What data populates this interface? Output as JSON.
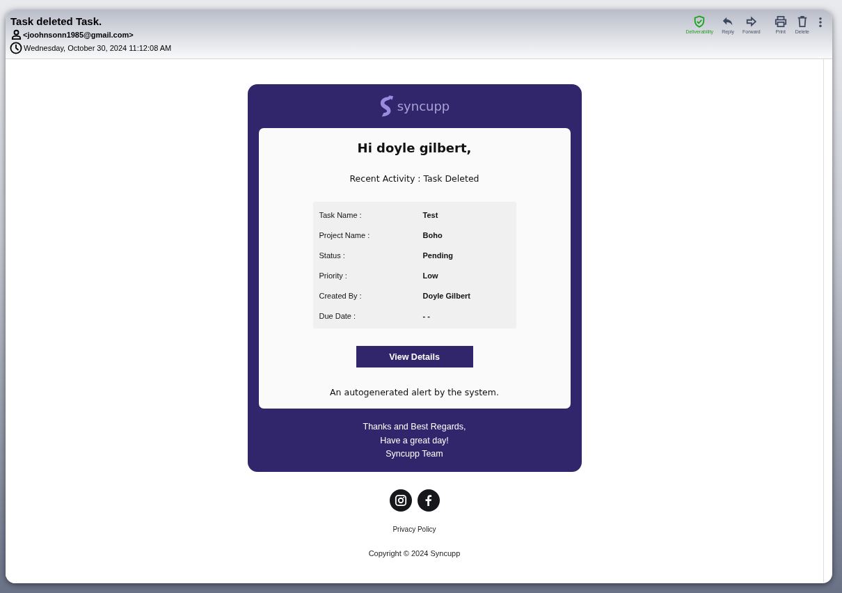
{
  "message": {
    "subject": "Task deleted Task.",
    "sender": "<joohnsonn1985@gmail.com>",
    "date": "Wednesday, October 30, 2024 11:12:08 AM"
  },
  "toolbar": [
    {
      "kind": "deliverability",
      "label": "Deliverability"
    },
    {
      "kind": "reply",
      "label": "Reply"
    },
    {
      "kind": "forward",
      "label": "Forward"
    },
    {
      "kind": "print",
      "label": "Print"
    },
    {
      "kind": "delete",
      "label": "Delete"
    },
    {
      "kind": "more"
    }
  ],
  "email": {
    "logo_text": "syncupp",
    "greeting": "Hi doyle gilbert,",
    "activity": "Recent Activity : Task Deleted",
    "details": [
      {
        "label": "Task Name :",
        "value": "Test"
      },
      {
        "label": "Project Name :",
        "value": "Boho"
      },
      {
        "label": "Status :",
        "value": "Pending"
      },
      {
        "label": "Priority :",
        "value": "Low"
      },
      {
        "label": "Created By :",
        "value": "Doyle Gilbert"
      },
      {
        "label": "Due Date :",
        "value": "- -"
      }
    ],
    "button": "View Details",
    "note": "An autogenerated alert by the system.",
    "signoff": [
      "Thanks and Best Regards,",
      "Have a great day!",
      "Syncupp Team"
    ]
  },
  "footer": {
    "social": [
      {
        "kind": "instagram"
      },
      {
        "kind": "facebook"
      }
    ],
    "privacy_link": "Privacy Policy",
    "copyright": "Copyright © 2024 Syncupp"
  }
}
